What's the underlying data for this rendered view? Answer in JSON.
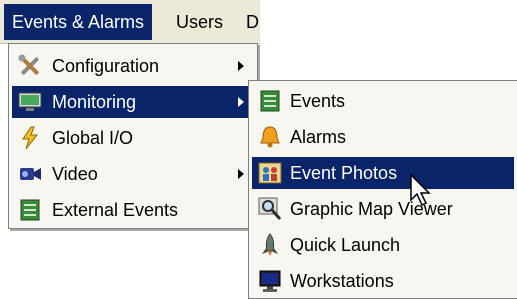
{
  "menubar": {
    "events_alarms": "Events & Alarms",
    "users": "Users",
    "partial": "D"
  },
  "main_menu": {
    "items": [
      {
        "label": "Configuration",
        "icon": "tools-icon",
        "has_submenu": true
      },
      {
        "label": "Monitoring",
        "icon": "monitor-icon",
        "has_submenu": true,
        "selected": true
      },
      {
        "label": "Global I/O",
        "icon": "lightning-icon",
        "has_submenu": false
      },
      {
        "label": "Video",
        "icon": "video-camera-icon",
        "has_submenu": true
      },
      {
        "label": "External Events",
        "icon": "external-events-icon",
        "has_submenu": false
      }
    ]
  },
  "monitoring_submenu": {
    "items": [
      {
        "label": "Events",
        "icon": "events-list-icon"
      },
      {
        "label": "Alarms",
        "icon": "alarm-bell-icon"
      },
      {
        "label": "Event Photos",
        "icon": "event-photos-icon",
        "selected": true
      },
      {
        "label": "Graphic Map Viewer",
        "icon": "magnifier-map-icon"
      },
      {
        "label": "Quick Launch",
        "icon": "rocket-icon"
      },
      {
        "label": "Workstations",
        "icon": "workstation-icon"
      }
    ]
  },
  "colors": {
    "highlight": "#0a246a",
    "menubar_bg": "#ece9d8",
    "menu_bg": "#f7f6f1"
  }
}
